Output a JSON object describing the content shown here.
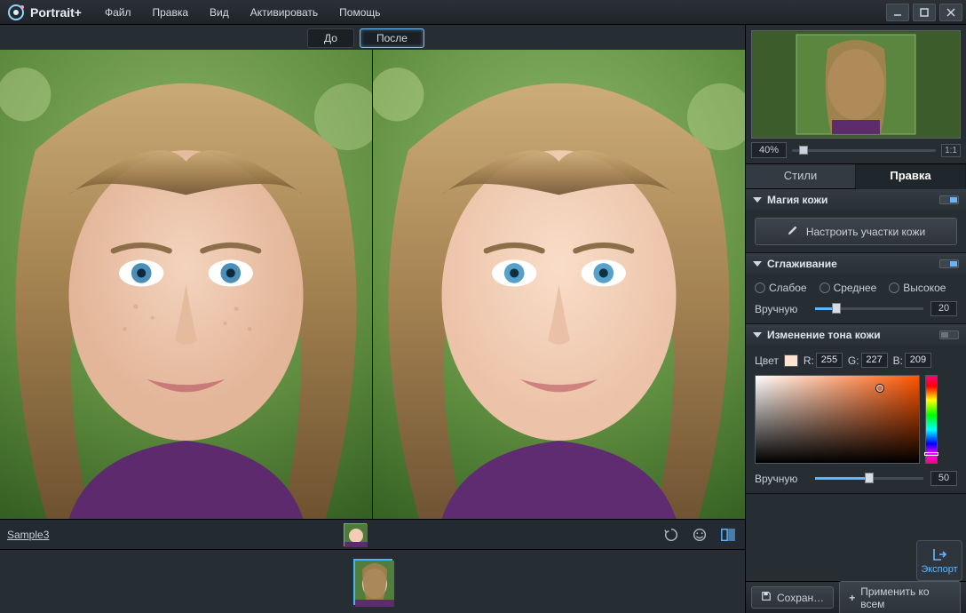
{
  "app": {
    "name": "Portrait+"
  },
  "menu": [
    "Файл",
    "Правка",
    "Вид",
    "Активировать",
    "Помощь"
  ],
  "window_buttons": [
    "minimize",
    "maximize",
    "close"
  ],
  "view_tabs": {
    "before": "До",
    "after": "После"
  },
  "preview": {
    "zoom_percent": "40%",
    "one_to_one": "1:1"
  },
  "side_tabs": {
    "styles": "Стили",
    "edit": "Правка"
  },
  "panels": {
    "skin_magic": {
      "title": "Магия кожи",
      "configure_btn": "Настроить участки кожи",
      "enabled": true
    },
    "smoothing": {
      "title": "Сглаживание",
      "enabled": true,
      "options": {
        "weak": "Слабое",
        "medium": "Среднее",
        "strong": "Высокое"
      },
      "manual_label": "Вручную",
      "manual_value": "20"
    },
    "skin_tone": {
      "title": "Изменение тона кожи",
      "enabled": false,
      "color_label": "Цвет",
      "r_label": "R:",
      "r_value": "255",
      "g_label": "G:",
      "g_value": "227",
      "b_label": "B:",
      "b_value": "209",
      "manual_label": "Вручную",
      "manual_value": "50"
    }
  },
  "strip": {
    "filename": "Sample3"
  },
  "bottom": {
    "save": "Сохран…",
    "apply_all": "Применить ко всем",
    "export": "Экспорт"
  }
}
